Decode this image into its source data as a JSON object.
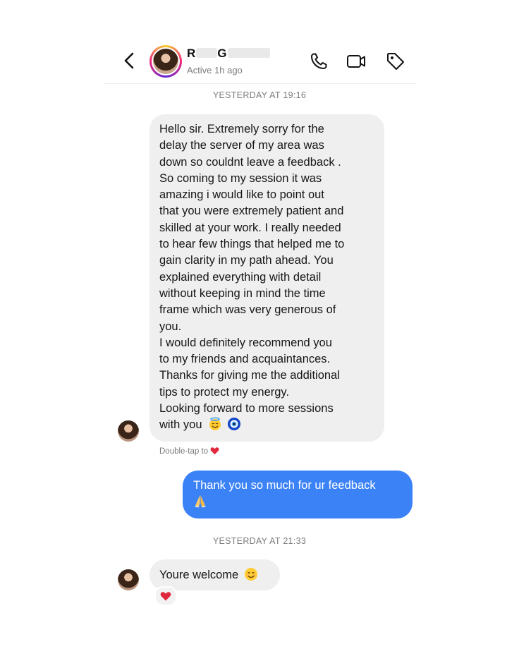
{
  "header": {
    "back_icon": "chevron-left-icon",
    "name_first_initial": "R",
    "name_second_initial": "G",
    "status": "Active 1h ago",
    "actions": [
      "phone-icon",
      "video-icon",
      "tag-icon"
    ]
  },
  "messages": [
    {
      "type": "timestamp",
      "text": "YESTERDAY AT 19:16"
    },
    {
      "type": "incoming",
      "lines": [
        "Hello sir. Extremely sorry for the",
        "delay the server of my area was",
        "down so couldnt leave a feedback .",
        "So coming to my session it was",
        "amazing i would like to point out",
        "that you were extremely patient and",
        "skilled at your work. I really needed",
        "to hear few things that helped me to",
        "gain clarity in my path ahead. You",
        "explained everything with detail",
        "without keeping in mind the time",
        "frame which was very generous of",
        "you.",
        "I would definitely recommend you",
        "to my friends and acquaintances.",
        "Thanks for giving me the additional",
        "tips to protect my energy.",
        "Looking forward to more sessions",
        "with you"
      ],
      "emoji": [
        "smiling-face-with-halo",
        "nazar-amulet"
      ],
      "hint": "Double-tap to"
    },
    {
      "type": "outgoing",
      "line1": "Thank you so much for ur feedback",
      "line2_emoji": "folded-hands"
    },
    {
      "type": "timestamp",
      "text": "YESTERDAY AT 21:33"
    },
    {
      "type": "incoming",
      "text": "Youre welcome",
      "emoji": "smiling-face",
      "reaction": "red-heart"
    }
  ],
  "colors": {
    "outgoing_bubble": "#3b82f6",
    "incoming_bubble": "#efefef",
    "heart": "#e0283c"
  }
}
